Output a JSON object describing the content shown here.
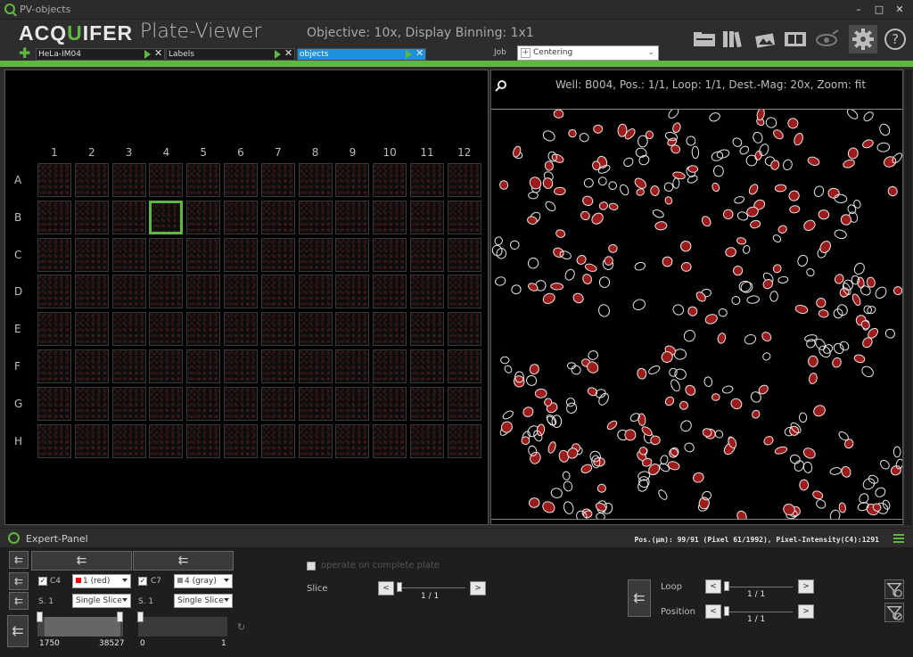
{
  "window": {
    "title": "PV-objects",
    "minimize": "–",
    "maximize": "□",
    "close": "✕"
  },
  "header": {
    "logo_pre": "ACQ",
    "logo_q": "U",
    "logo_post": "IFER",
    "app_name": "Plate-Viewer",
    "objective": "Objective: 10x, Display Binning: 1x1",
    "add_symbol": "✚",
    "tabs": [
      {
        "label": "HeLa-IM04",
        "active": false
      },
      {
        "label": "Labels",
        "active": false
      },
      {
        "label": "objects",
        "active": true
      }
    ],
    "close_symbol": "✕",
    "job_label": "Job",
    "job_plus": "+",
    "job_value": "Centering",
    "job_chevron": "⌄"
  },
  "toolbar": {
    "icons": [
      "folder-icon",
      "library-icon",
      "image-stack-icon",
      "film-icon",
      "eye-icon",
      "gear-icon",
      "help-icon"
    ],
    "accent": "#5fb741"
  },
  "plate": {
    "columns": [
      "1",
      "2",
      "3",
      "4",
      "5",
      "6",
      "7",
      "8",
      "9",
      "10",
      "11",
      "12"
    ],
    "rows": [
      "A",
      "B",
      "C",
      "D",
      "E",
      "F",
      "G",
      "H"
    ],
    "selected_well": "B4"
  },
  "image": {
    "info": "Well: B004, Pos.: 1/1, Loop: 1/1, Dest.-Mag: 20x, Zoom: fit"
  },
  "expert": {
    "title": "Expert-Panel",
    "position_readout": "Pos.(µm): 99/91 (Pixel 61/1992), Pixel-Intensity(C4):1291",
    "back_symbol": "⇇",
    "channel1": {
      "name": "C4",
      "color_label": "1 (red)",
      "color": "#ff0000",
      "slice_label": "S. 1",
      "slice_mode": "Single Slice",
      "min": "1750",
      "max": "38527",
      "checked": "✓"
    },
    "channel2": {
      "name": "C7",
      "color_label": "4 (gray)",
      "color": "#8a8a8a",
      "slice_label": "S. 1",
      "slice_mode": "Single Slice",
      "min": "0",
      "max": "1",
      "checked": "✓"
    },
    "reset_symbol": "↻",
    "operate_label": "operate on complete plate",
    "slice_label": "Slice",
    "slice_value": "1 / 1",
    "loop_label": "Loop",
    "loop_value": "1 / 1",
    "position_label": "Position",
    "position_value": "1 / 1",
    "prev": "<",
    "next": ">"
  }
}
